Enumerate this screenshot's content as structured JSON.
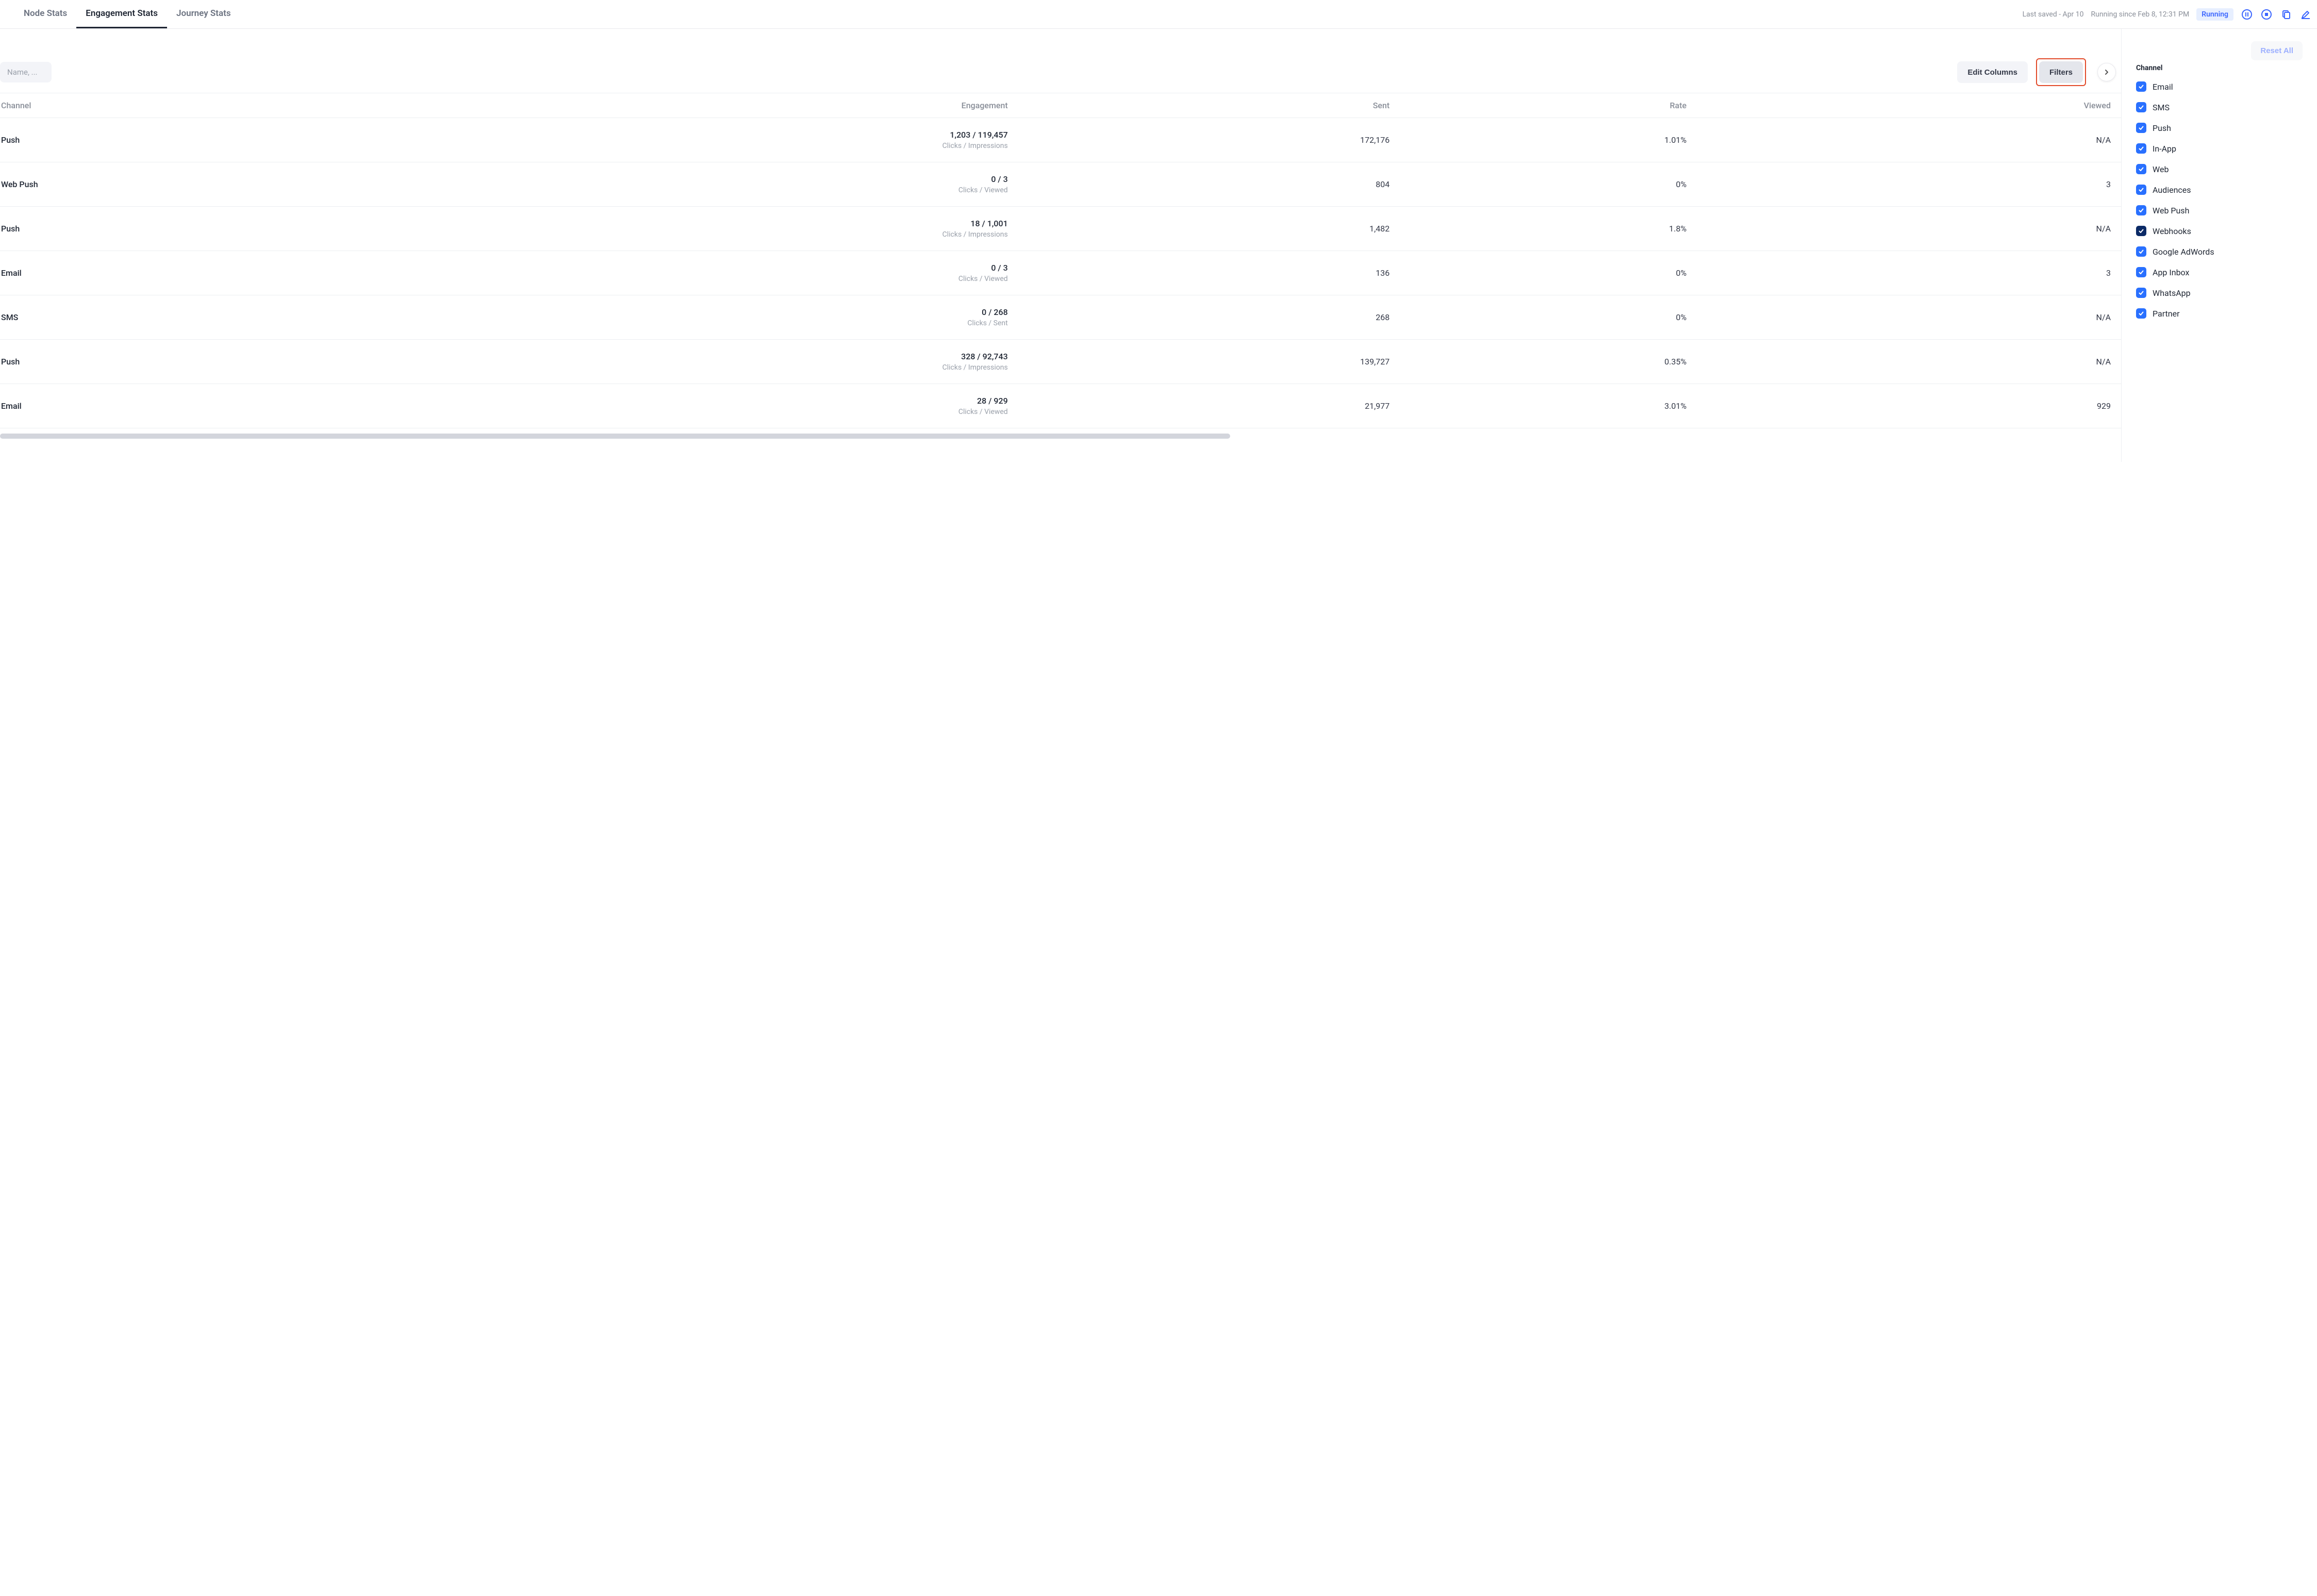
{
  "header": {
    "tabs": [
      {
        "label": "Node Stats",
        "active": false
      },
      {
        "label": "Engagement Stats",
        "active": true
      },
      {
        "label": "Journey Stats",
        "active": false
      }
    ],
    "last_saved": "Last saved - Apr 10",
    "running_since": "Running since Feb 8, 12:31 PM",
    "running_badge": "Running"
  },
  "toolbar": {
    "search_placeholder": "Name, ...",
    "edit_columns": "Edit Columns",
    "filters": "Filters"
  },
  "table": {
    "columns": {
      "channel": "Channel",
      "engagement": "Engagement",
      "sent": "Sent",
      "rate": "Rate",
      "viewed": "Viewed"
    },
    "rows": [
      {
        "channel": "Push",
        "engagement": "1,203 / 119,457",
        "engagement_sub": "Clicks / Impressions",
        "sent": "172,176",
        "rate": "1.01%",
        "viewed": "N/A"
      },
      {
        "channel": "Web Push",
        "engagement": "0 / 3",
        "engagement_sub": "Clicks / Viewed",
        "sent": "804",
        "rate": "0%",
        "viewed": "3"
      },
      {
        "channel": "Push",
        "engagement": "18 / 1,001",
        "engagement_sub": "Clicks / Impressions",
        "sent": "1,482",
        "rate": "1.8%",
        "viewed": "N/A"
      },
      {
        "channel": "Email",
        "engagement": "0 / 3",
        "engagement_sub": "Clicks / Viewed",
        "sent": "136",
        "rate": "0%",
        "viewed": "3"
      },
      {
        "channel": "SMS",
        "engagement": "0 / 268",
        "engagement_sub": "Clicks / Sent",
        "sent": "268",
        "rate": "0%",
        "viewed": "N/A"
      },
      {
        "channel": "Push",
        "engagement": "328 / 92,743",
        "engagement_sub": "Clicks / Impressions",
        "sent": "139,727",
        "rate": "0.35%",
        "viewed": "N/A"
      },
      {
        "channel": "Email",
        "engagement": "28 / 929",
        "engagement_sub": "Clicks / Viewed",
        "sent": "21,977",
        "rate": "3.01%",
        "viewed": "929"
      }
    ]
  },
  "sidepanel": {
    "reset": "Reset All",
    "section_title": "Channel",
    "filters": [
      {
        "label": "Email",
        "checked": true,
        "dark": false
      },
      {
        "label": "SMS",
        "checked": true,
        "dark": false
      },
      {
        "label": "Push",
        "checked": true,
        "dark": false
      },
      {
        "label": "In-App",
        "checked": true,
        "dark": false
      },
      {
        "label": "Web",
        "checked": true,
        "dark": false
      },
      {
        "label": "Audiences",
        "checked": true,
        "dark": false
      },
      {
        "label": "Web Push",
        "checked": true,
        "dark": false
      },
      {
        "label": "Webhooks",
        "checked": true,
        "dark": true
      },
      {
        "label": "Google AdWords",
        "checked": true,
        "dark": false
      },
      {
        "label": "App Inbox",
        "checked": true,
        "dark": false
      },
      {
        "label": "WhatsApp",
        "checked": true,
        "dark": false
      },
      {
        "label": "Partner",
        "checked": true,
        "dark": false
      }
    ]
  }
}
